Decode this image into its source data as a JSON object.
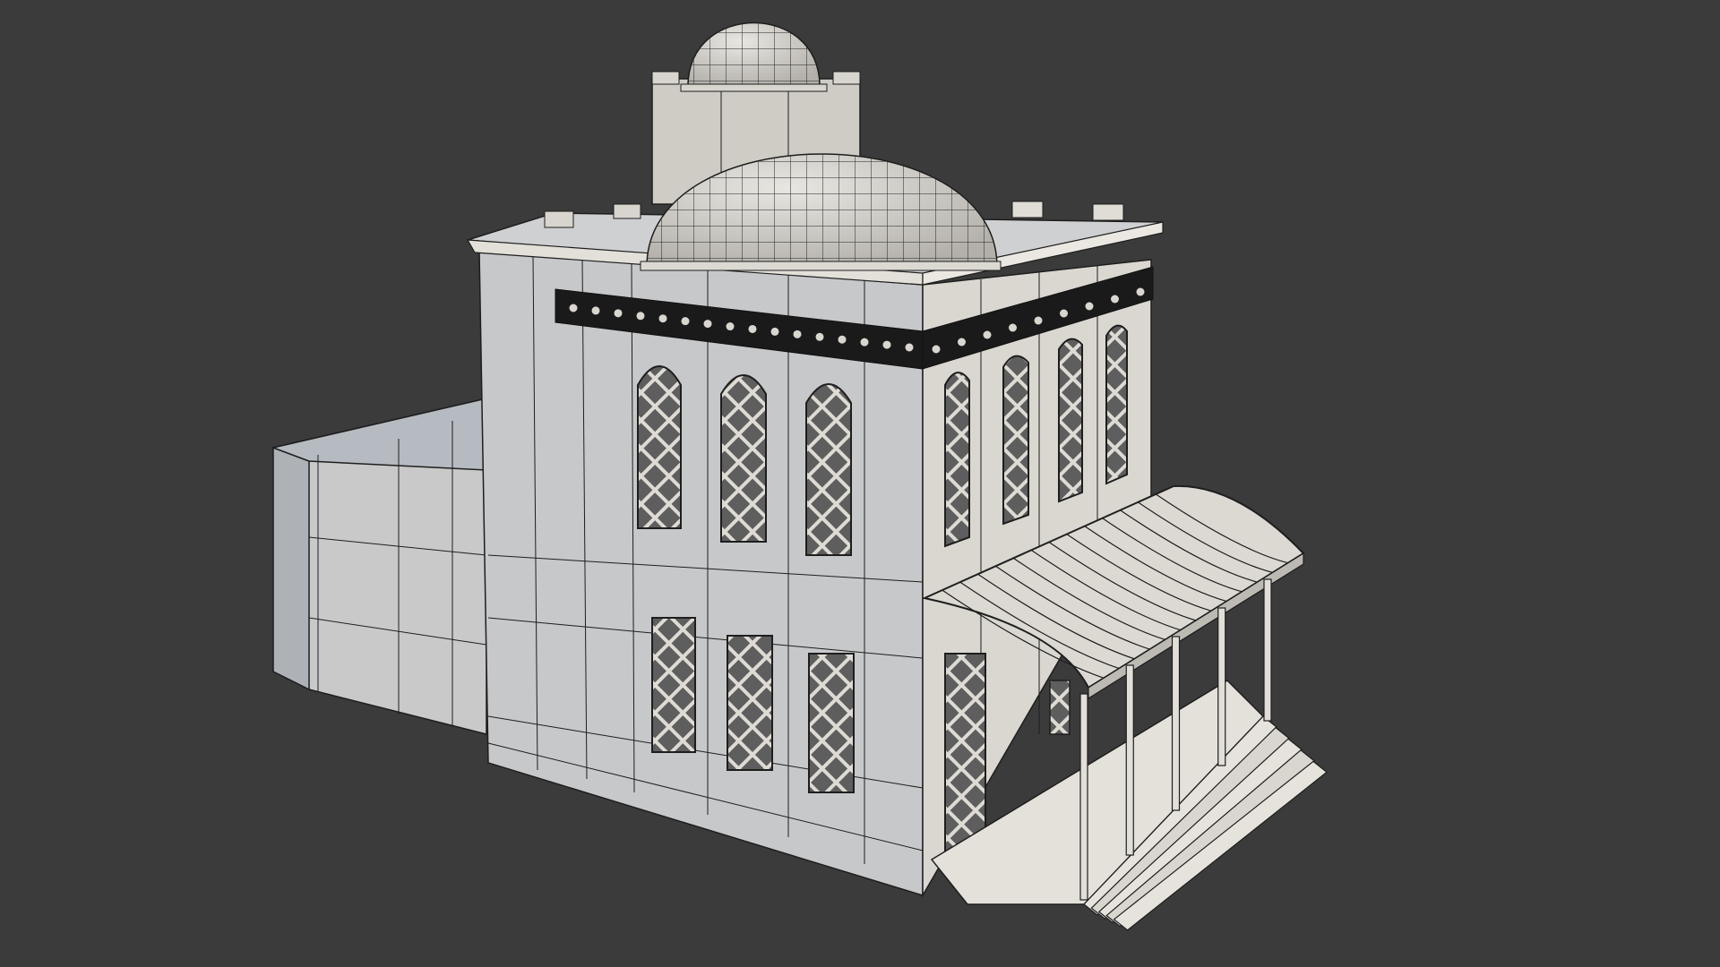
{
  "scene": {
    "subject": "building-wireframe-render",
    "colors": {
      "background": "#3b3b3b",
      "wall_light": "#d6d3cc",
      "wall_mid": "#b9b6b0",
      "wall_shadow": "#9fa3a8",
      "wire": "#1e1e1e",
      "frieze": "#1a1a1a"
    },
    "front_windows_upper": 3,
    "front_windows_lower": 3,
    "side_windows_upper": 4,
    "porch_columns": 5,
    "stair_steps": 5
  }
}
